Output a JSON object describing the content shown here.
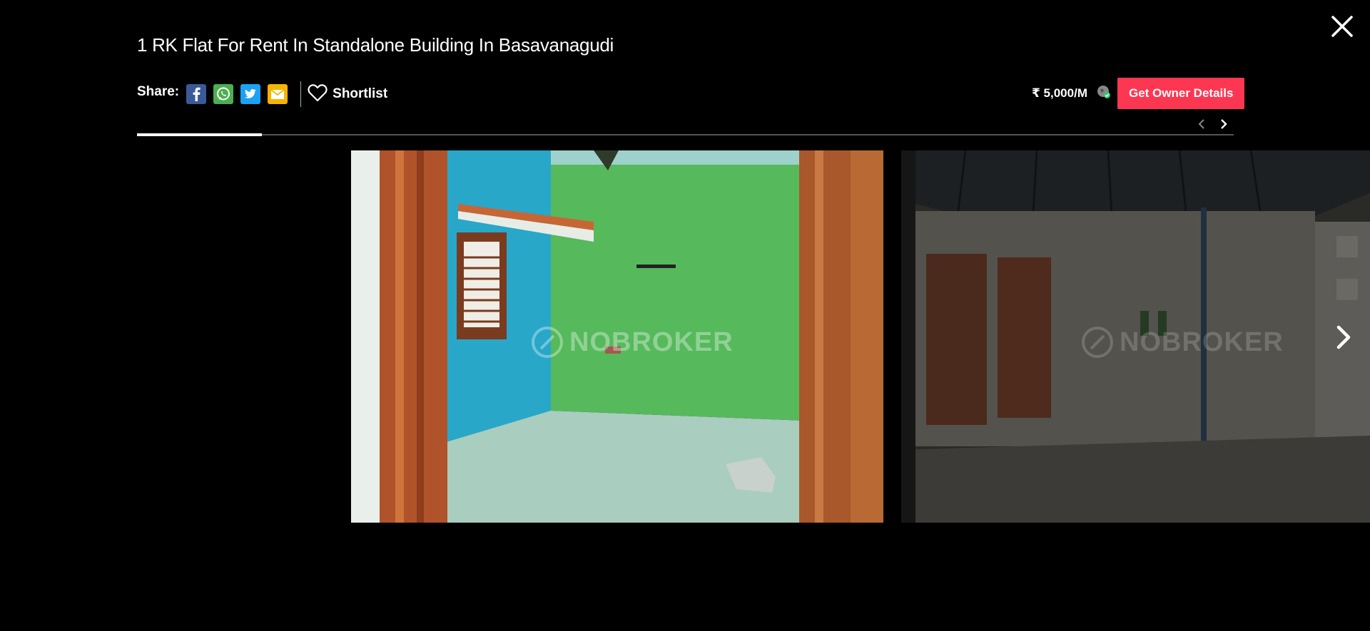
{
  "listing": {
    "title": "1 RK Flat For Rent In Standalone Building In Basavanagudi",
    "price": "₹ 5,000/M",
    "get_owner_label": "Get Owner Details"
  },
  "share": {
    "label": "Share:",
    "icons": [
      "facebook-icon",
      "whatsapp-icon",
      "twitter-icon",
      "email-icon"
    ]
  },
  "shortlist": {
    "label": "Shortlist"
  },
  "gallery": {
    "progress_fraction": 0.114,
    "watermark": "NOBROKER",
    "photos": [
      "photo-room-green-wall",
      "photo-terrace-covered"
    ]
  },
  "colors": {
    "accent": "#fd3752",
    "background": "#000000",
    "facebook": "#3b5998",
    "whatsapp": "#4caf50",
    "twitter": "#1da1f2",
    "email": "#f5b400"
  }
}
